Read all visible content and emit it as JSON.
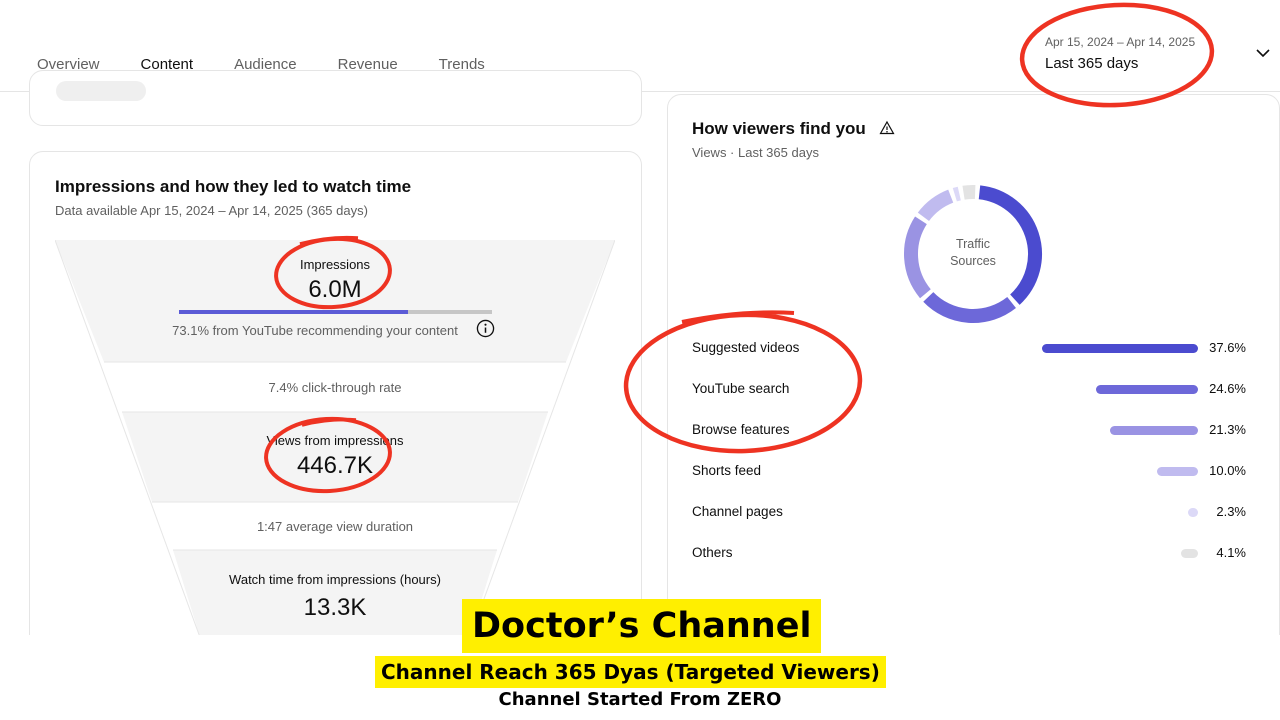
{
  "tabs": [
    {
      "label": "Overview",
      "active": false
    },
    {
      "label": "Content",
      "active": true
    },
    {
      "label": "Audience",
      "active": false
    },
    {
      "label": "Revenue",
      "active": false
    },
    {
      "label": "Trends",
      "active": false
    }
  ],
  "date_picker": {
    "range": "Apr 15, 2024 – Apr 14, 2025",
    "label": "Last 365 days"
  },
  "impressions_card": {
    "title": "Impressions and how they led to watch time",
    "subtitle": "Data available Apr 15, 2024 – Apr 14, 2025 (365 days)",
    "impressions_label": "Impressions",
    "impressions_value": "6.0M",
    "recommendation_fraction": 0.731,
    "recommendation_text": "73.1% from YouTube recommending your content",
    "ctr_text": "7.4% click-through rate",
    "views_label": "Views from impressions",
    "views_value": "446.7K",
    "avg_duration_text": "1:47 average view duration",
    "watch_time_label": "Watch time from impressions (hours)",
    "watch_time_value": "13.3K"
  },
  "traffic_card": {
    "title": "How viewers find you",
    "subtitle": "Views · Last 365 days",
    "donut_label_line1": "Traffic",
    "donut_label_line2": "Sources",
    "sources": [
      {
        "name": "Suggested videos",
        "value": 37.6,
        "pct": "37.6%",
        "color": "#4b4bcf"
      },
      {
        "name": "YouTube search",
        "value": 24.6,
        "pct": "24.6%",
        "color": "#6d68d9"
      },
      {
        "name": "Browse features",
        "value": 21.3,
        "pct": "21.3%",
        "color": "#9a93e3"
      },
      {
        "name": "Shorts feed",
        "value": 10.0,
        "pct": "10.0%",
        "color": "#c0bbef"
      },
      {
        "name": "Channel pages",
        "value": 2.3,
        "pct": "2.3%",
        "color": "#dcd9f7"
      },
      {
        "name": "Others",
        "value": 4.1,
        "pct": "4.1%",
        "color": "#e3e3e3"
      }
    ]
  },
  "caption": {
    "line1": "Doctor’s Channel",
    "line2": "Channel Reach 365 Dyas (Targeted Viewers)",
    "line3": "Channel Started From ZERO"
  },
  "colors": {
    "accent": "#5b5bd6",
    "annotation": "#ee3322",
    "highlight": "#ffef00"
  }
}
